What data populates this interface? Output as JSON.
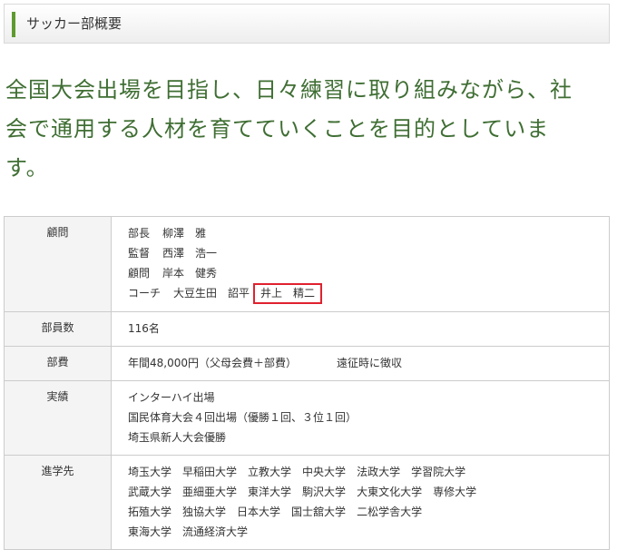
{
  "section": {
    "title": "サッカー部概要"
  },
  "lead": {
    "lines": [
      "全国大会出場を目指し、日々練習に取り組みながら、社",
      "会で通用する人材を育てていくことを目的としていま",
      "す。"
    ]
  },
  "table": {
    "advisor": {
      "label": "顧問",
      "rows": [
        {
          "role": "部長",
          "name": "柳澤　雅"
        },
        {
          "role": "監督",
          "name": "西澤　浩一"
        },
        {
          "role": "顧問",
          "name": "岸本　健秀"
        },
        {
          "role": "コーチ",
          "name": "大豆生田　詔平",
          "highlighted": "井上　精二"
        }
      ]
    },
    "members": {
      "label": "部員数",
      "value": "116名"
    },
    "fee": {
      "label": "部費",
      "value": "年間48,000円（父母会費＋部費）",
      "note": "遠征時に徴収"
    },
    "results": {
      "label": "実績",
      "lines": [
        "インターハイ出場",
        "国民体育大会４回出場（優勝１回、３位１回）",
        "埼玉県新人大会優勝"
      ]
    },
    "career": {
      "label": "進学先",
      "lines": [
        [
          "埼玉大学",
          "早稲田大学",
          "立教大学",
          "中央大学",
          "法政大学",
          "学習院大学"
        ],
        [
          "武蔵大学",
          "亜細亜大学",
          "東洋大学",
          "駒沢大学",
          "大東文化大学",
          "専修大学"
        ],
        [
          "拓殖大学",
          "独協大学",
          "日本大学",
          "国士舘大学",
          "二松学舎大学"
        ],
        [
          "東海大学",
          "流通経済大学"
        ]
      ]
    }
  },
  "colors": {
    "accent": "#5f9a2f",
    "lead_text": "#3f6e33",
    "highlight_border": "#e0212f"
  }
}
